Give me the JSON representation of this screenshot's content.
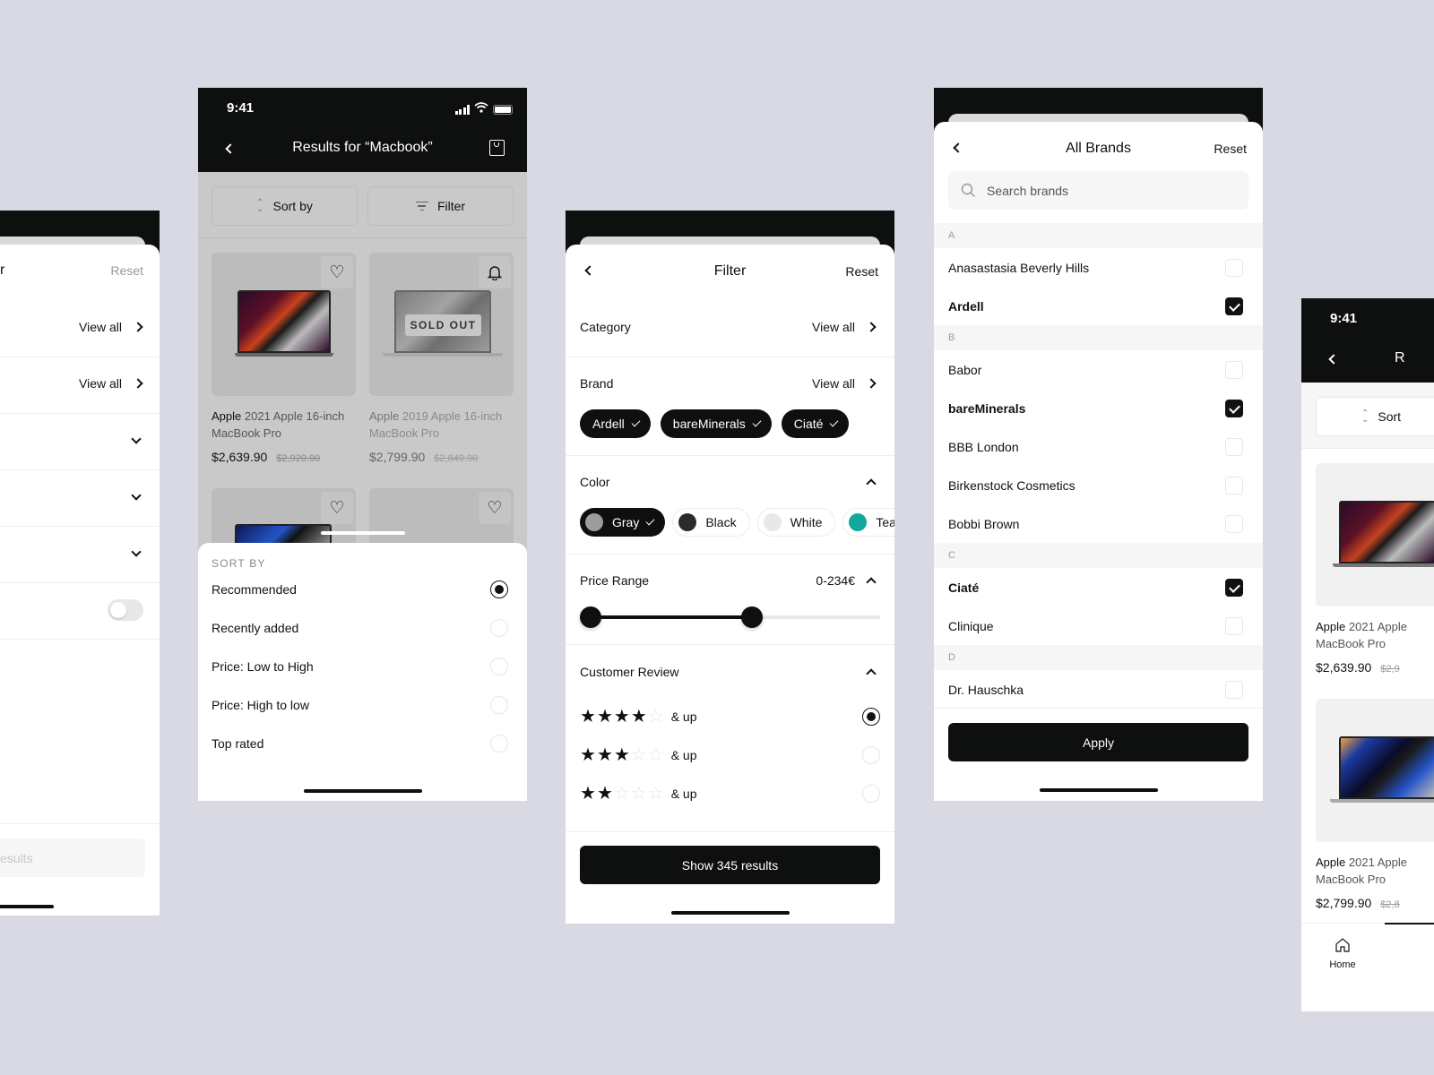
{
  "colors": {
    "background": "#d8d9e2",
    "primary": "#0e0f0f",
    "teal": "#13a89e",
    "gray_swatch": "#9d9d9d",
    "black_swatch": "#2b2b2d",
    "white_swatch": "#e8e8e8"
  },
  "screen_filter_left": {
    "reset_label": "Reset",
    "title_fragment": "r",
    "rows": [
      {
        "type": "view-all",
        "label": "View all"
      },
      {
        "type": "view-all",
        "label": "View all"
      },
      {
        "type": "collapsed"
      },
      {
        "type": "collapsed"
      },
      {
        "type": "collapsed"
      },
      {
        "type": "toggle",
        "on": false
      }
    ],
    "show_button_fragment": "esults"
  },
  "screen_results": {
    "status_time": "9:41",
    "title": "Results for “Macbook”",
    "sort_label": "Sort by",
    "filter_label": "Filter",
    "products": [
      {
        "brand": "Apple",
        "name": "2021 Apple 16-inch",
        "name2": "MacBook Pro",
        "price": "$2,639.90",
        "old_price": "$2,920.90",
        "action_icon": "heart-icon",
        "sold_out": false
      },
      {
        "brand": "Apple",
        "name": "2019 Apple 16-inch",
        "name2": "MacBook Pro",
        "price": "$2,799.90",
        "old_price": "$2,849.90",
        "action_icon": "bell-icon",
        "sold_out": true,
        "sold_out_label": "SOLD OUT"
      }
    ],
    "sort_sheet": {
      "heading": "SORT BY",
      "options": [
        {
          "label": "Recommended",
          "selected": true
        },
        {
          "label": "Recently added",
          "selected": false
        },
        {
          "label": "Price: Low to High",
          "selected": false
        },
        {
          "label": "Price: High to low",
          "selected": false
        },
        {
          "label": "Top rated",
          "selected": false
        }
      ]
    }
  },
  "screen_filter": {
    "title": "Filter",
    "reset_label": "Reset",
    "category_label": "Category",
    "category_view_all": "View all",
    "brand_label": "Brand",
    "brand_view_all": "View all",
    "brand_chips": [
      "Ardell",
      "bareMinerals",
      "Ciaté"
    ],
    "color_label": "Color",
    "color_chips": [
      {
        "label": "Gray",
        "selected": true
      },
      {
        "label": "Black",
        "selected": false
      },
      {
        "label": "White",
        "selected": false
      },
      {
        "label": "Teal",
        "selected": false
      }
    ],
    "price_label": "Price Range",
    "price_value": "0-234€",
    "price_range_fraction": [
      0.0,
      0.58
    ],
    "review_label": "Customer Review",
    "review_options": [
      {
        "stars": 4,
        "suffix": "& up",
        "selected": true
      },
      {
        "stars": 3,
        "suffix": "& up",
        "selected": false
      },
      {
        "stars": 2,
        "suffix": "& up",
        "selected": false
      }
    ],
    "show_button": "Show 345 results"
  },
  "screen_brands": {
    "title": "All Brands",
    "reset_label": "Reset",
    "search_placeholder": "Search brands",
    "groups": [
      {
        "letter": "A",
        "items": [
          {
            "name": "Anasastasia Beverly Hills",
            "checked": false
          },
          {
            "name": "Ardell",
            "checked": true
          }
        ]
      },
      {
        "letter": "B",
        "items": [
          {
            "name": "Babor",
            "checked": false
          },
          {
            "name": "bareMinerals",
            "checked": true
          },
          {
            "name": "BBB London",
            "checked": false
          },
          {
            "name": "Birkenstock Cosmetics",
            "checked": false
          },
          {
            "name": "Bobbi Brown",
            "checked": false
          }
        ]
      },
      {
        "letter": "C",
        "items": [
          {
            "name": "Ciaté",
            "checked": true
          },
          {
            "name": "Clinique",
            "checked": false
          }
        ]
      },
      {
        "letter": "D",
        "items": [
          {
            "name": "Dr. Hauschka",
            "checked": false
          }
        ]
      }
    ],
    "apply_label": "Apply"
  },
  "screen_results_right": {
    "status_time": "9:41",
    "title_fragment": "R",
    "sort_fragment": "Sort",
    "products": [
      {
        "brand": "Apple",
        "name": "2021 Apple",
        "name2": "MacBook Pro",
        "price": "$2,639.90",
        "old_price": "$2,9"
      },
      {
        "brand": "Apple",
        "name": "2021 Apple",
        "name2": "MacBook Pro",
        "price": "$2,799.90",
        "old_price": "$2,8"
      }
    ],
    "tab_home": "Home"
  }
}
